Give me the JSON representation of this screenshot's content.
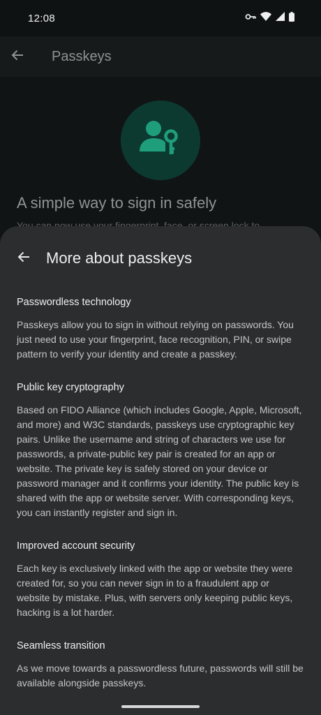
{
  "status_bar": {
    "time": "12:08",
    "icons": [
      "vpn-key-icon",
      "wifi-icon",
      "cellular-signal-icon",
      "battery-icon"
    ]
  },
  "app_bar": {
    "back_icon": "arrow-back-icon",
    "title": "Passkeys"
  },
  "background": {
    "hero_icon": "person-key-icon",
    "title": "A simple way to sign in safely",
    "subtitle": "You can now use your fingerprint, face, or screen lock to"
  },
  "sheet": {
    "back_icon": "arrow-back-icon",
    "title": "More about passkeys",
    "sections": [
      {
        "heading": "Passwordless technology",
        "body": "Passkeys allow you to sign in without relying on passwords. You just need to use your fingerprint, face recognition, PIN, or swipe pattern to verify your identity and create a passkey."
      },
      {
        "heading": "Public key cryptography",
        "body": "Based on FIDO Alliance (which includes Google, Apple, Microsoft, and more) and W3C standards, passkeys use cryptographic key pairs. Unlike the username and string of characters we use for passwords, a private-public key pair is created for an app or website. The private key is safely stored on your device or password manager and it confirms your identity. The public key is shared with the app or website server. With corresponding keys, you can instantly register and sign in."
      },
      {
        "heading": "Improved account security",
        "body": "Each key is exclusively linked with the app or website they were created for, so you can never sign in to a fraudulent app or website by mistake. Plus, with servers only keeping public keys, hacking is a lot harder."
      },
      {
        "heading": "Seamless transition",
        "body": "As we move towards a passwordless future, passwords will still be available alongside passkeys."
      }
    ]
  },
  "colors": {
    "sheet_background": "#2c2d2e",
    "accent_green": "#1f9e7c",
    "hero_circle": "#0d3a30"
  }
}
